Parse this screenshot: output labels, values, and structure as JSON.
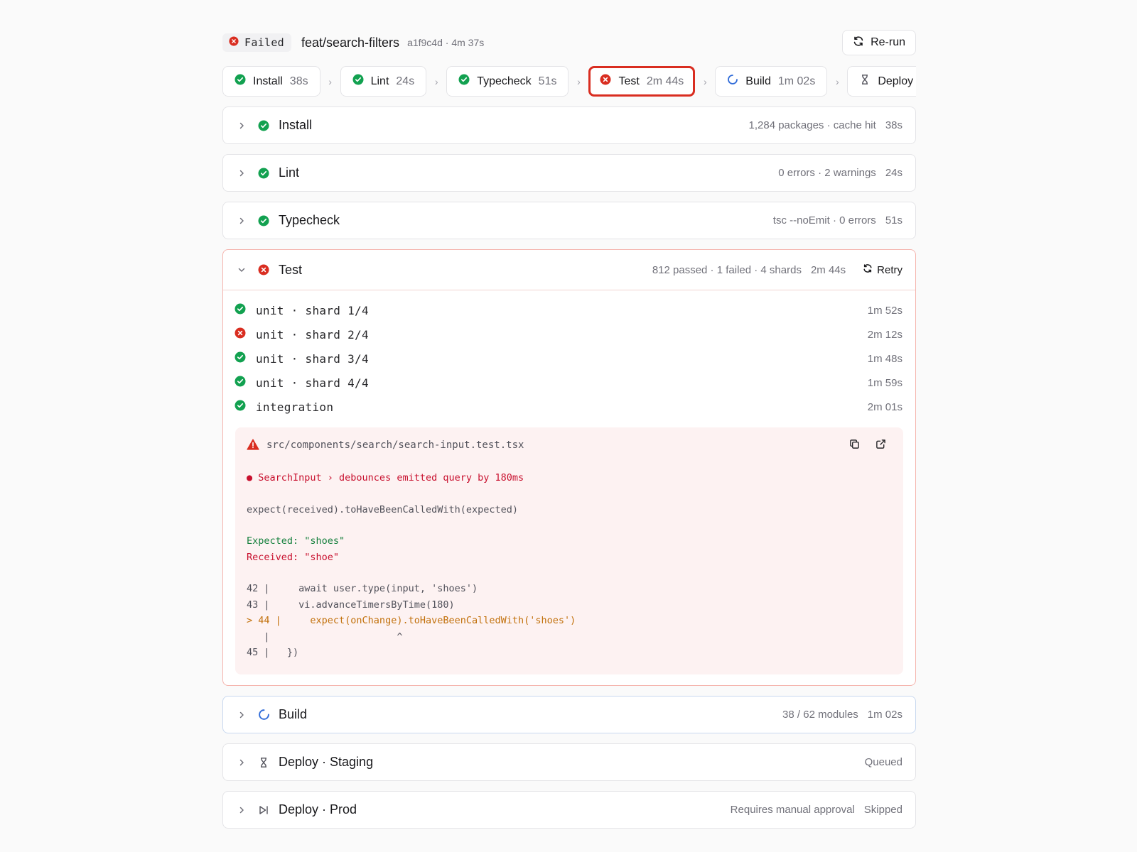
{
  "header": {
    "status_label": "Failed",
    "branch": "feat/search-filters",
    "commit_meta": "a1f9c4d · 4m 37s",
    "rerun_label": "Re-run"
  },
  "stepper": [
    {
      "label": "Install",
      "duration": "38s",
      "status": "success"
    },
    {
      "label": "Lint",
      "duration": "24s",
      "status": "success"
    },
    {
      "label": "Typecheck",
      "duration": "51s",
      "status": "success"
    },
    {
      "label": "Test",
      "duration": "2m 44s",
      "status": "failed"
    },
    {
      "label": "Build",
      "duration": "1m 02s",
      "status": "running"
    },
    {
      "label": "Deploy",
      "duration": "",
      "status": "queued"
    }
  ],
  "stages": {
    "install": {
      "title": "Install",
      "meta": "1,284 packages · cache hit",
      "duration": "38s"
    },
    "lint": {
      "title": "Lint",
      "meta": "0 errors · 2 warnings",
      "duration": "24s"
    },
    "typecheck": {
      "title": "Typecheck",
      "meta": "tsc --noEmit · 0 errors",
      "duration": "51s"
    },
    "test": {
      "title": "Test",
      "meta": "812 passed · 1 failed · 4 shards",
      "duration": "2m 44s",
      "retry_label": "Retry",
      "shards": [
        {
          "name": "unit · shard 1/4",
          "duration": "1m 52s",
          "status": "success"
        },
        {
          "name": "unit · shard 2/4",
          "duration": "2m 12s",
          "status": "failed"
        },
        {
          "name": "unit · shard 3/4",
          "duration": "1m 48s",
          "status": "success"
        },
        {
          "name": "unit · shard 4/4",
          "duration": "1m 59s",
          "status": "success"
        },
        {
          "name": "integration",
          "duration": "2m 01s",
          "status": "success"
        }
      ],
      "error": {
        "file": "src/components/search/search-input.test.tsx",
        "test_name": "● SearchInput › debounces emitted query by 180ms",
        "assertion": "expect(received).toHaveBeenCalledWith(expected)",
        "expected": "Expected: \"shoes\"",
        "received": "Received: \"shoe\"",
        "code": [
          "42 |     await user.type(input, 'shoes')",
          "43 |     vi.advanceTimersByTime(180)",
          "> 44 |     expect(onChange).toHaveBeenCalledWith('shoes')",
          "   |                      ^",
          "45 |   })"
        ]
      }
    },
    "build": {
      "title": "Build",
      "meta": "38 / 62 modules",
      "duration": "1m 02s"
    },
    "deploy_staging": {
      "title": "Deploy · Staging",
      "meta": "",
      "duration": "Queued"
    },
    "deploy_prod": {
      "title": "Deploy · Prod",
      "meta": "Requires manual approval",
      "duration": "Skipped"
    }
  },
  "colors": {
    "success": "#12a150",
    "failed": "#d92d20",
    "running": "#2f6bd8",
    "border": "#e4e4e7"
  },
  "icons": {
    "success": "check-circle-icon",
    "failed": "x-circle-icon",
    "running": "spinner-icon",
    "queued": "hourglass-icon",
    "skipped": "skip-icon"
  }
}
